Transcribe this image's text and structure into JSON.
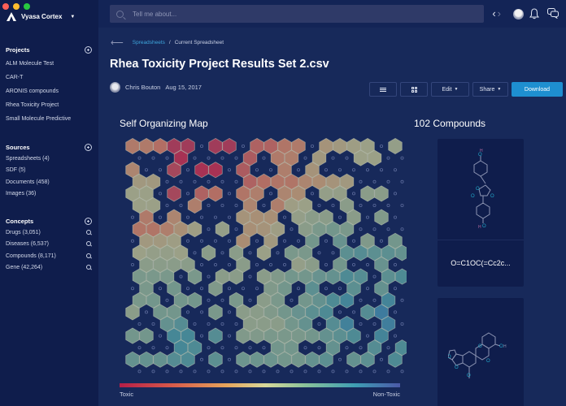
{
  "app": {
    "name": "Vyasa Cortex",
    "traffic_colors": [
      "#ff5f57",
      "#febc2e",
      "#28c840"
    ]
  },
  "sidebar": {
    "projects": {
      "title": "Projects",
      "items": [
        "ALM Molecule Test",
        "CAR-T",
        "ARONIS compounds",
        "Rhea Toxicity Project",
        "Small Molecule Predictive"
      ]
    },
    "sources": {
      "title": "Sources",
      "items": [
        "Spreadsheets (4)",
        "SDF (5)",
        "Documents (458)",
        "Images (36)"
      ]
    },
    "concepts": {
      "title": "Concepts",
      "items": [
        "Drugs (3,051)",
        "Diseases (6,537)",
        "Compounds (8,171)",
        "Gene (42,264)"
      ]
    }
  },
  "topbar": {
    "search_placeholder": "Tell me about...",
    "back_glyph": "‹",
    "forward_glyph": "›"
  },
  "breadcrumb": {
    "link": "Spreadsheets",
    "separator": "/",
    "current": "Current Spreadsheet"
  },
  "page": {
    "title": "Rhea Toxicity Project Results Set 2.csv",
    "author": "Chris Bouton",
    "date": "Aug 15, 2017"
  },
  "toolbar": {
    "edit_label": "Edit",
    "share_label": "Share",
    "download_label": "Download",
    "accent": "#1e8fd0"
  },
  "som": {
    "title": "Self Organizing Map",
    "legend_min": "Toxic",
    "legend_max": "Non-Toxic",
    "grid": [
      [
        0.3,
        0.3,
        0.25,
        0.12,
        0.12,
        null,
        0.12,
        0.12,
        null,
        0.22,
        0.22,
        0.28,
        0.3,
        null,
        0.42,
        0.45,
        0.48,
        0.5,
        null,
        0.52
      ],
      [
        null,
        null,
        null,
        0.08,
        null,
        null,
        null,
        null,
        0.2,
        null,
        0.3,
        0.32,
        null,
        0.45,
        null,
        null,
        0.5,
        0.5,
        null,
        null
      ],
      [
        0.35,
        null,
        null,
        0.15,
        null,
        0.08,
        0.08,
        null,
        0.2,
        null,
        null,
        0.32,
        null,
        0.42,
        null,
        null,
        null,
        null,
        null,
        null
      ],
      [
        0.45,
        0.45,
        null,
        null,
        null,
        null,
        null,
        null,
        0.22,
        0.25,
        0.28,
        0.28,
        0.35,
        0.38,
        0.42,
        0.45,
        null,
        null,
        null,
        null
      ],
      [
        0.5,
        0.5,
        null,
        0.15,
        null,
        0.22,
        0.25,
        null,
        0.28,
        0.32,
        null,
        0.35,
        0.38,
        null,
        0.52,
        0.52,
        null,
        0.55,
        0.55,
        null
      ],
      [
        0.5,
        0.5,
        null,
        null,
        0.32,
        null,
        null,
        null,
        0.35,
        null,
        0.32,
        0.48,
        0.5,
        null,
        null,
        0.55,
        null,
        null,
        null,
        null
      ],
      [
        null,
        0.3,
        null,
        0.35,
        null,
        null,
        null,
        null,
        0.42,
        0.4,
        0.4,
        null,
        0.52,
        0.55,
        0.55,
        null,
        0.55,
        null,
        0.58,
        null
      ],
      [
        0.28,
        0.28,
        0.32,
        0.4,
        0.48,
        null,
        0.52,
        null,
        0.4,
        0.42,
        0.48,
        null,
        0.55,
        0.6,
        0.62,
        0.6,
        null,
        null,
        null,
        null
      ],
      [
        null,
        0.45,
        0.45,
        0.48,
        null,
        null,
        null,
        null,
        0.38,
        null,
        0.45,
        null,
        null,
        0.62,
        null,
        0.65,
        null,
        0.58,
        null,
        0.62
      ],
      [
        0.5,
        0.52,
        0.52,
        0.5,
        null,
        0.55,
        null,
        0.55,
        null,
        0.5,
        null,
        0.6,
        0.6,
        null,
        null,
        0.68,
        0.7,
        0.68,
        0.68,
        0.66
      ],
      [
        null,
        0.55,
        0.55,
        0.55,
        0.55,
        null,
        null,
        null,
        0.55,
        null,
        null,
        null,
        0.52,
        0.55,
        null,
        0.62,
        null,
        null,
        0.65,
        null
      ],
      [
        0.6,
        0.6,
        0.6,
        null,
        0.6,
        null,
        0.55,
        0.55,
        null,
        0.55,
        0.58,
        0.62,
        0.62,
        0.65,
        0.66,
        0.72,
        0.7,
        null,
        0.68,
        0.72
      ],
      [
        null,
        0.6,
        null,
        0.62,
        null,
        null,
        0.58,
        null,
        null,
        null,
        0.58,
        0.62,
        null,
        0.68,
        null,
        null,
        0.68,
        null,
        0.66,
        null
      ],
      [
        0.6,
        0.62,
        null,
        0.62,
        0.62,
        null,
        null,
        0.6,
        null,
        0.55,
        0.6,
        null,
        0.62,
        0.66,
        0.72,
        0.76,
        null,
        null,
        0.76,
        null
      ],
      [
        0.55,
        null,
        0.62,
        0.62,
        null,
        null,
        0.6,
        null,
        0.55,
        0.55,
        0.58,
        0.62,
        0.65,
        0.68,
        0.72,
        null,
        null,
        0.7,
        0.82,
        null
      ],
      [
        null,
        null,
        0.66,
        0.7,
        null,
        null,
        null,
        null,
        0.55,
        0.55,
        0.55,
        0.62,
        0.66,
        null,
        0.7,
        0.78,
        null,
        null,
        0.8,
        null
      ],
      [
        0.62,
        0.62,
        null,
        0.74,
        0.74,
        null,
        0.7,
        null,
        0.58,
        0.58,
        0.6,
        0.6,
        0.6,
        0.62,
        0.66,
        0.68,
        0.72,
        null,
        0.76,
        null
      ],
      [
        null,
        null,
        null,
        0.74,
        0.72,
        null,
        null,
        null,
        null,
        null,
        0.62,
        0.62,
        null,
        null,
        0.66,
        null,
        null,
        0.7,
        null,
        0.72
      ],
      [
        0.66,
        0.66,
        0.66,
        0.7,
        0.72,
        null,
        0.68,
        null,
        0.64,
        0.64,
        0.64,
        0.62,
        0.62,
        0.66,
        0.68,
        null,
        0.66,
        0.68,
        null,
        0.72
      ],
      [
        null,
        null,
        null,
        null,
        null,
        null,
        null,
        null,
        null,
        null,
        null,
        null,
        null,
        null,
        null,
        null,
        null,
        null,
        null,
        null
      ]
    ]
  },
  "compounds": {
    "title": "102 Compounds",
    "cards": [
      {
        "smiles": "O=C1OC(=Cc2c..."
      },
      {
        "smiles": ""
      }
    ]
  }
}
